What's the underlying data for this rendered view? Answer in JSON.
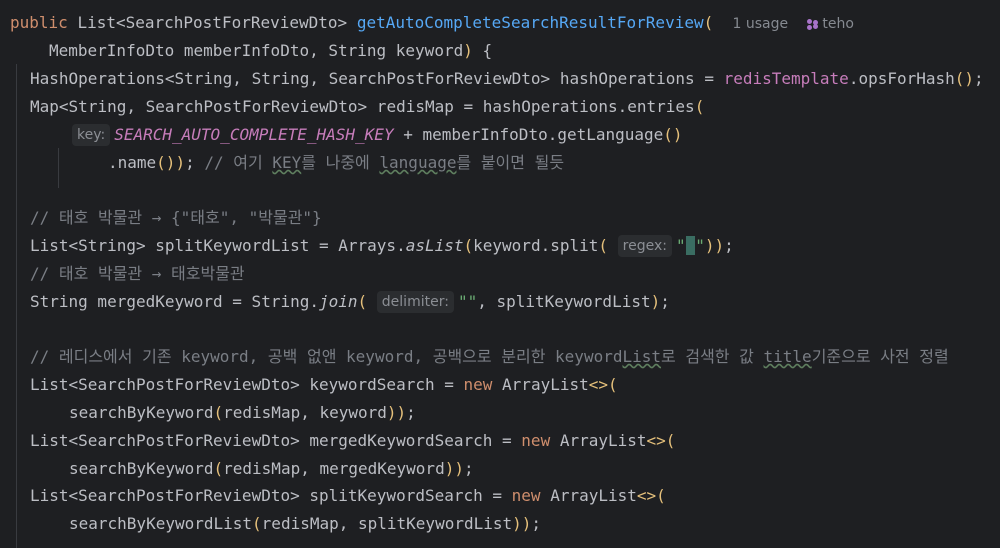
{
  "header": {
    "kw_public": "public",
    "type_list": "List",
    "type_dto": "SearchPostForReviewDto",
    "method_name": "getAutoCompleteSearchResultForReview",
    "usages": "1 usage",
    "author": "teho"
  },
  "params": {
    "text1": "MemberInfoDto memberInfoDto, String keyword",
    "tail": " {"
  },
  "hash_line": {
    "decl": "HashOperations",
    "generic": "String, String, SearchPostForReviewDto",
    "rest": " hashOperations = ",
    "field": "redisTemplate",
    "call": ".opsForHash",
    "end": ";"
  },
  "map_line": {
    "decl": "Map",
    "generic": "String, SearchPostForReviewDto",
    "rest": " redisMap = hashOperations.entries"
  },
  "key_line": {
    "hint": "key:",
    "const": "SEARCH_AUTO_COMPLETE_HASH_KEY",
    "rest": " + memberInfoDto.getLanguage"
  },
  "name_line": {
    "code": ".name",
    "end": ";",
    "comment_a": "// 여기 ",
    "comment_key": "KEY",
    "comment_b": "를 나중에 ",
    "comment_lang": "language",
    "comment_c": "를 붙이면 될듯"
  },
  "comment1": "// 태호 박물관 → {\"태호\", \"박물관\"}",
  "split_line": {
    "decl": "List",
    "generic": "String",
    "rest": " splitKeywordList = Arrays.",
    "method": "asList",
    "call": "keyword.split",
    "hint": "regex:",
    "q1": "\"",
    "space": " ",
    "q2": "\"",
    "end": ";"
  },
  "comment2": "// 태호 박물관 → 태호박물관",
  "merged_line": {
    "code": "String mergedKeyword = String.",
    "method": "join",
    "hint": "delimiter:",
    "str": "\"\"",
    "rest": ", splitKeywordList",
    "end": ";"
  },
  "comment3": {
    "a": "// 레디스에서 기존 keyword, 공백 없앤 keyword, 공백으로 분리한 keyword",
    "list": "List",
    "b": "로 검색한 값 ",
    "title": "title",
    "c": "기준으로 사전 정렬"
  },
  "keyword_search": {
    "decl": "List",
    "generic": "SearchPostForReviewDto",
    "rest": " keywordSearch = ",
    "kw_new": "new",
    "ctor": " ArrayList",
    "call": "searchByKeyword",
    "args": "redisMap, keyword"
  },
  "merged_search": {
    "decl": "List",
    "generic": "SearchPostForReviewDto",
    "rest": " mergedKeywordSearch = ",
    "kw_new": "new",
    "ctor": " ArrayList",
    "call": "searchByKeyword",
    "args": "redisMap, mergedKeyword"
  },
  "split_search": {
    "decl": "List",
    "generic": "SearchPostForReviewDto",
    "rest": " splitKeywordSearch = ",
    "kw_new": "new",
    "ctor": " ArrayList",
    "call": "searchByKeywordList",
    "args": "redisMap, splitKeywordList"
  }
}
